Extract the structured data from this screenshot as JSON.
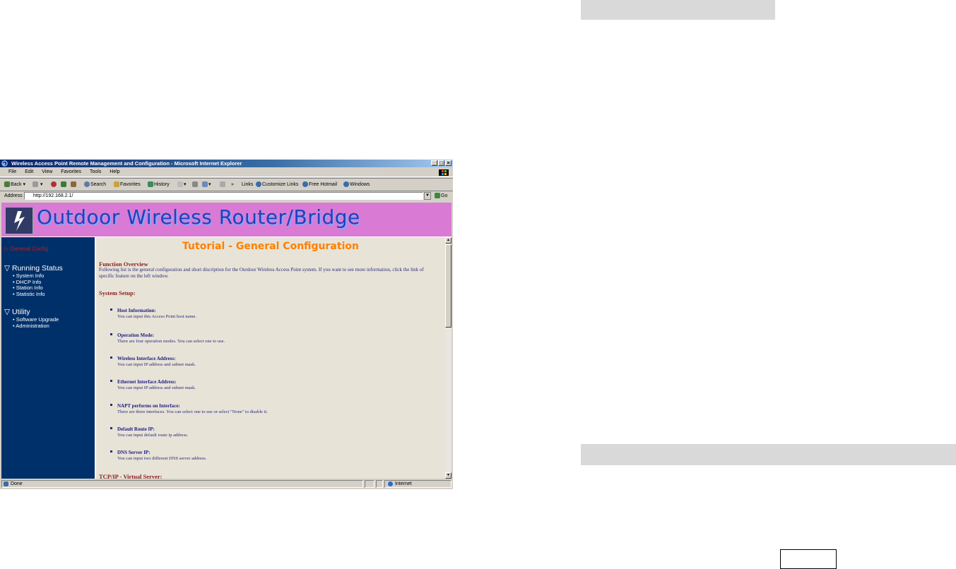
{
  "window": {
    "title": "Wireless Access Point Remote Management and Configuration - Microsoft Internet Explorer",
    "controls": [
      "_",
      "□",
      "×"
    ]
  },
  "menu": [
    "File",
    "Edit",
    "View",
    "Favorites",
    "Tools",
    "Help"
  ],
  "toolbar": {
    "back": "Back",
    "search": "Search",
    "favorites": "Favorites",
    "history": "History",
    "links": "Links",
    "customize_links": "Customize Links",
    "free_hotmail": "Free Hotmail",
    "windows": "Windows"
  },
  "address": {
    "label": "Address",
    "url": "http://192.168.2.1/",
    "go": "Go"
  },
  "banner": {
    "title": "Outdoor Wireless Router/Bridge"
  },
  "nav": {
    "active": "General Config",
    "running_status": "Running Status",
    "running_items": [
      "System Info",
      "DHCP Info",
      "Station Info",
      "Statistic Info"
    ],
    "utility": "Utility",
    "utility_items": [
      "Software Upgrade",
      "Administration"
    ]
  },
  "content": {
    "title": "Tutorial - General Configuration",
    "overview_heading": "Function Overview",
    "overview_text": "Following list is the general configuration and short discription for the Ourdoor Wireless Access Point system. If you want to see more information, click the link of specific feature on the left window.",
    "system_setup": "System Setup:",
    "items": [
      {
        "title": "Host Information:",
        "desc": "You can input this Access Point host name."
      },
      {
        "title": "Operation Mode:",
        "desc": "There are four operation modes. You can select one to use."
      },
      {
        "title": "Wireless Interface Address:",
        "desc": "You can input IP address and subnet mask."
      },
      {
        "title": "Ethernet Interface Address:",
        "desc": "You can input IP address and subnet mask."
      },
      {
        "title": "NAPT performs on Interface:",
        "desc": "There are three interfaces. You can select one to use or select \"None\" to disable it."
      },
      {
        "title": "Default Route IP:",
        "desc": "You can input default route ip address."
      },
      {
        "title": "DNS Server IP:",
        "desc": "You can input two different DNS server address."
      }
    ],
    "next_heading": "TCP/IP - Virtual Server:"
  },
  "status": {
    "left": "Done",
    "zone": "Internet"
  }
}
